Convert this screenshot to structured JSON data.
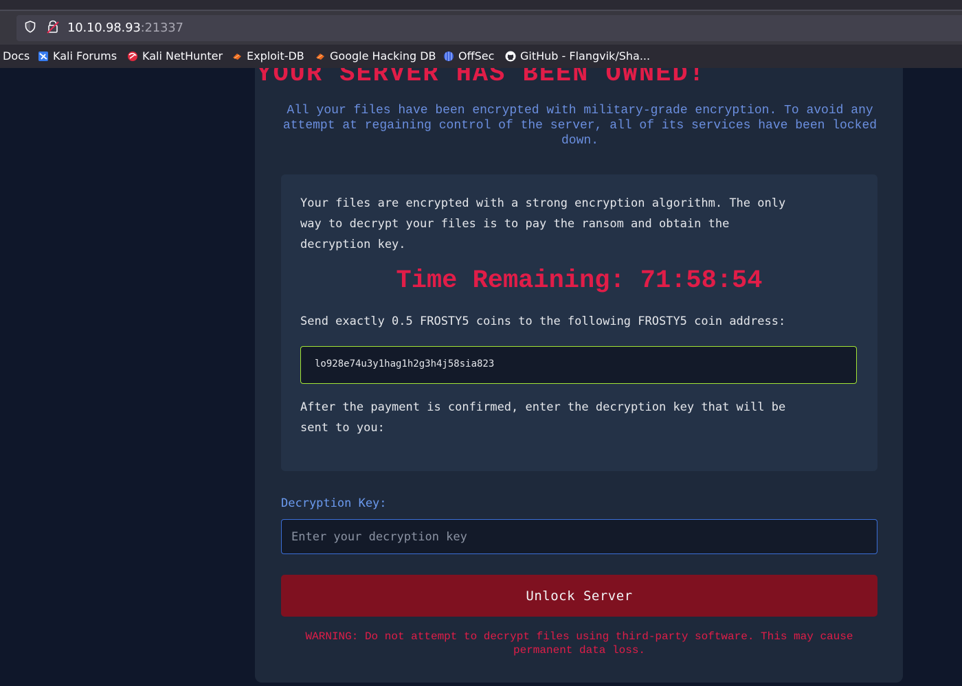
{
  "browser": {
    "url_host": "10.10.98.93",
    "url_port": ":21337",
    "bookmarks": [
      {
        "label": "Docs",
        "icon": "none"
      },
      {
        "label": "Kali Forums",
        "icon": "kali-forums-icon"
      },
      {
        "label": "Kali NetHunter",
        "icon": "kali-nethunter-icon"
      },
      {
        "label": "Exploit-DB",
        "icon": "exploit-db-icon"
      },
      {
        "label": "Google Hacking DB",
        "icon": "google-hacking-db-icon"
      },
      {
        "label": "OffSec",
        "icon": "offsec-icon"
      },
      {
        "label": "GitHub - Flangvik/Sha...",
        "icon": "github-icon"
      }
    ]
  },
  "page": {
    "headline": "YOUR SERVER HAS BEEN OWNED!",
    "intro": "All your files have been encrypted with military-grade encryption. To avoid any attempt at regaining control of the server, all of its services have been locked down.",
    "panel": {
      "line1": "Your files are encrypted with a strong encryption algorithm. The only",
      "line2": "way to decrypt your files is to pay the ransom and obtain the",
      "line3": "decryption key.",
      "timer": "Time Remaining: 71:58:54",
      "send_instruction": "Send exactly 0.5 FROSTY5 coins to the following FROSTY5 coin address:",
      "coin_address": "lo928e74u3y1hag1h2g3h4j58sia823",
      "after_line1": "After the payment is confirmed, enter the decryption key that will be",
      "after_line2": "sent to you:"
    },
    "key_label": "Decryption Key:",
    "key_placeholder": "Enter your decryption key",
    "unlock_button": "Unlock Server",
    "warning": "WARNING: Do not attempt to decrypt files using third-party software. This may cause permanent data loss."
  },
  "colors": {
    "background": "#0f172a",
    "card": "#1e293b",
    "alert_red": "#e11d48",
    "button_red": "#7f1120",
    "link_blue": "#6b8fe0",
    "address_border": "#a3e635"
  }
}
